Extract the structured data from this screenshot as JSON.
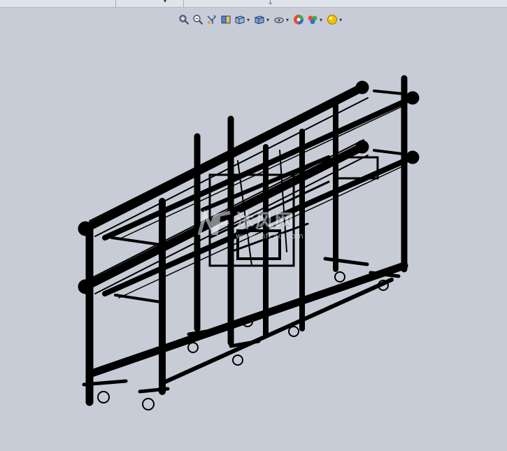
{
  "heads_up_toolbar": {
    "tools": [
      {
        "icon": "zoom-to-fit-icon",
        "has_dropdown": false
      },
      {
        "icon": "zoom-to-area-icon",
        "has_dropdown": false
      },
      {
        "icon": "previous-view-icon",
        "has_dropdown": false
      },
      {
        "icon": "section-view-icon",
        "has_dropdown": false
      },
      {
        "icon": "view-orientation-icon",
        "has_dropdown": true
      },
      {
        "icon": "display-style-icon",
        "has_dropdown": true
      },
      {
        "icon": "hide-show-items-icon",
        "has_dropdown": true
      },
      {
        "icon": "edit-appearance-icon",
        "has_dropdown": false
      },
      {
        "icon": "apply-scene-icon",
        "has_dropdown": true
      },
      {
        "icon": "view-settings-icon",
        "has_dropdown": true
      }
    ]
  },
  "watermark": {
    "logo_letters": "MF",
    "brand": "沐风网",
    "url": "www.mfcad.com"
  },
  "colors": {
    "viewport_background": "#c8ccd6",
    "model_lines": "#000000"
  }
}
